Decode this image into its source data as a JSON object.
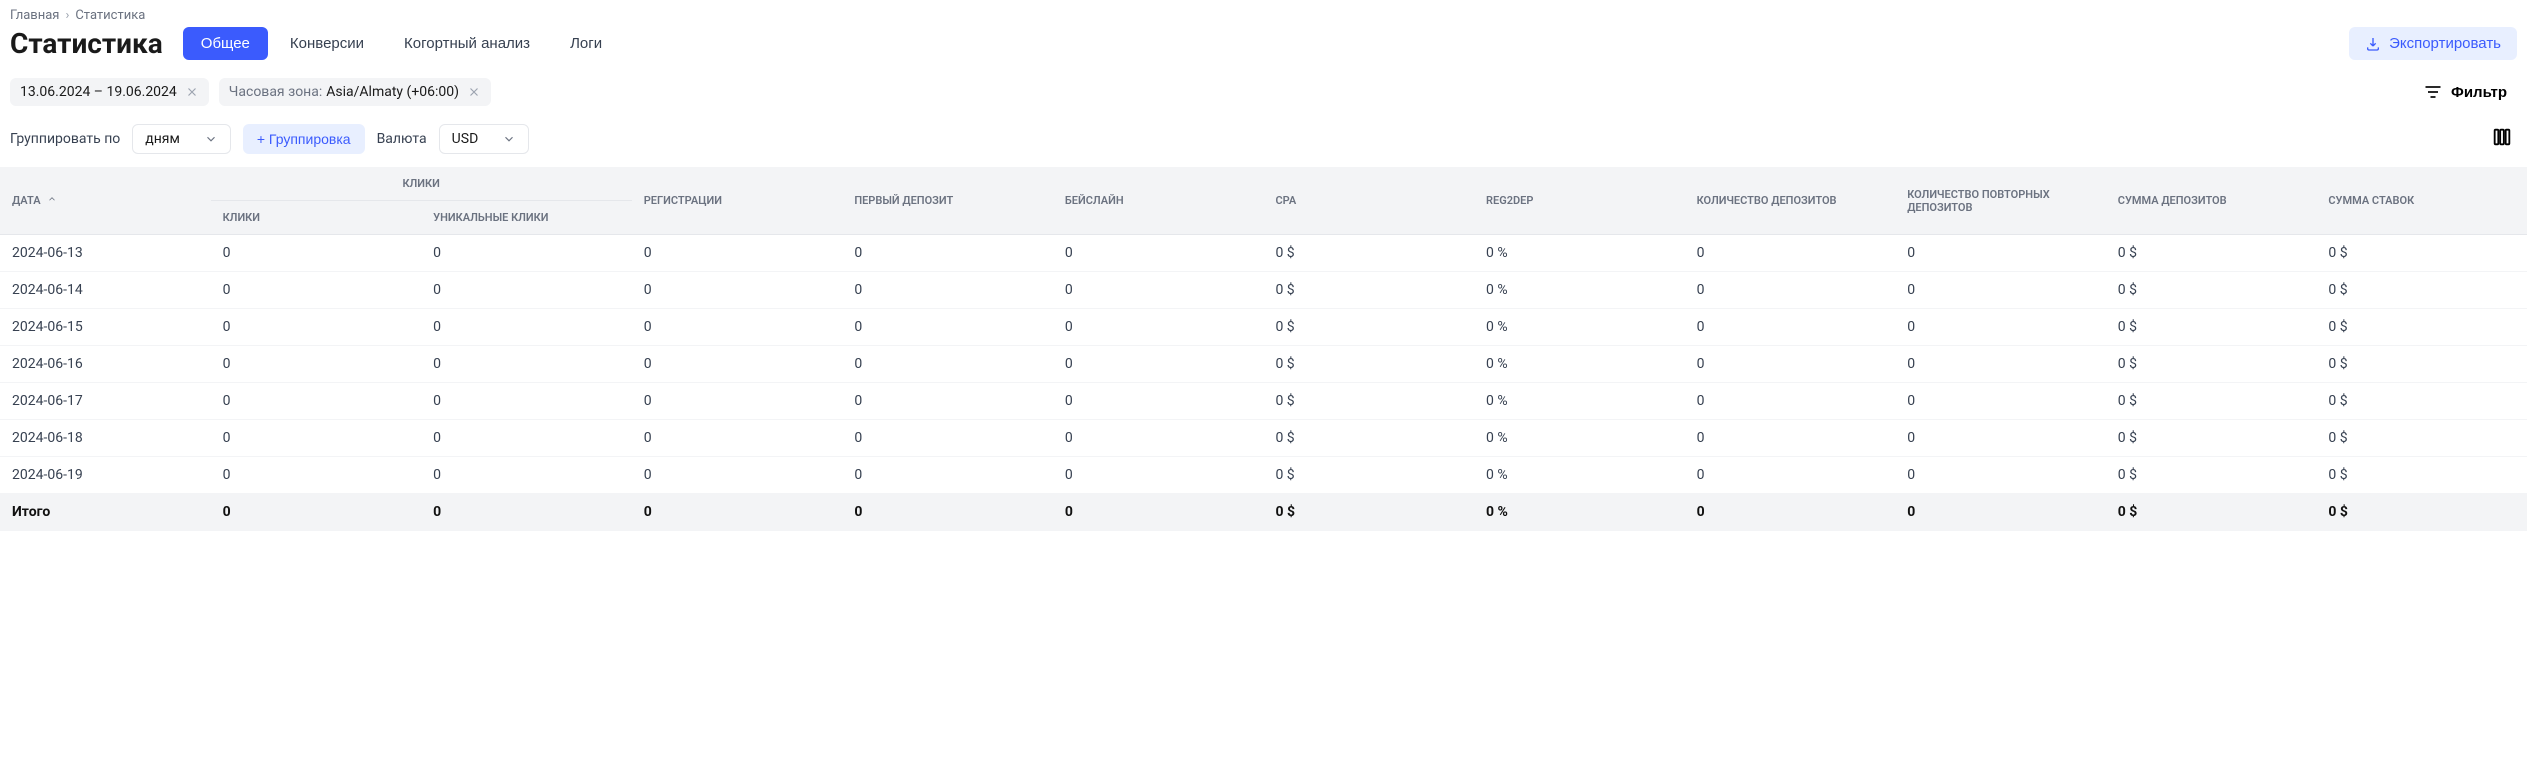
{
  "breadcrumb": {
    "home": "Главная",
    "current": "Статистика"
  },
  "pageTitle": "Статистика",
  "tabs": [
    "Общее",
    "Конверсии",
    "Когортный анализ",
    "Логи"
  ],
  "activeTab": 0,
  "exportLabel": "Экспортировать",
  "filterChips": {
    "dateRange": "13.06.2024 – 19.06.2024",
    "tzLabel": "Часовая зона:",
    "tzValue": "Asia/Almaty (+06:00)"
  },
  "filterBtn": "Фильтр",
  "controls": {
    "groupByLabel": "Группировать по",
    "groupByValue": "дням",
    "addGroupLabel": "+ Группировка",
    "currencyLabel": "Валюта",
    "currencyValue": "USD"
  },
  "columns": {
    "date": "ДАТА",
    "clicksGroup": "КЛИКИ",
    "clicks": "КЛИКИ",
    "uniqueClicks": "УНИКАЛЬНЫЕ КЛИКИ",
    "registrations": "РЕГИСТРАЦИИ",
    "firstDeposit": "ПЕРВЫЙ ДЕПОЗИТ",
    "baseline": "БЕЙСЛАЙН",
    "cpa": "CPA",
    "reg2dep": "REG2DEP",
    "depositsCount": "КОЛИЧЕСТВО ДЕПОЗИТОВ",
    "repeatDepositsCount": "КОЛИЧЕСТВО ПОВТОРНЫХ ДЕПОЗИТОВ",
    "depositsSum": "СУММА ДЕПОЗИТОВ",
    "betsSum": "СУММА СТАВОК"
  },
  "rows": [
    {
      "date": "2024-06-13",
      "clicks": "0",
      "uniqueClicks": "0",
      "registrations": "0",
      "firstDeposit": "0",
      "baseline": "0",
      "cpa": "0 $",
      "reg2dep": "0 %",
      "depositsCount": "0",
      "repeatDepositsCount": "0",
      "depositsSum": "0 $",
      "betsSum": "0 $"
    },
    {
      "date": "2024-06-14",
      "clicks": "0",
      "uniqueClicks": "0",
      "registrations": "0",
      "firstDeposit": "0",
      "baseline": "0",
      "cpa": "0 $",
      "reg2dep": "0 %",
      "depositsCount": "0",
      "repeatDepositsCount": "0",
      "depositsSum": "0 $",
      "betsSum": "0 $"
    },
    {
      "date": "2024-06-15",
      "clicks": "0",
      "uniqueClicks": "0",
      "registrations": "0",
      "firstDeposit": "0",
      "baseline": "0",
      "cpa": "0 $",
      "reg2dep": "0 %",
      "depositsCount": "0",
      "repeatDepositsCount": "0",
      "depositsSum": "0 $",
      "betsSum": "0 $"
    },
    {
      "date": "2024-06-16",
      "clicks": "0",
      "uniqueClicks": "0",
      "registrations": "0",
      "firstDeposit": "0",
      "baseline": "0",
      "cpa": "0 $",
      "reg2dep": "0 %",
      "depositsCount": "0",
      "repeatDepositsCount": "0",
      "depositsSum": "0 $",
      "betsSum": "0 $"
    },
    {
      "date": "2024-06-17",
      "clicks": "0",
      "uniqueClicks": "0",
      "registrations": "0",
      "firstDeposit": "0",
      "baseline": "0",
      "cpa": "0 $",
      "reg2dep": "0 %",
      "depositsCount": "0",
      "repeatDepositsCount": "0",
      "depositsSum": "0 $",
      "betsSum": "0 $"
    },
    {
      "date": "2024-06-18",
      "clicks": "0",
      "uniqueClicks": "0",
      "registrations": "0",
      "firstDeposit": "0",
      "baseline": "0",
      "cpa": "0 $",
      "reg2dep": "0 %",
      "depositsCount": "0",
      "repeatDepositsCount": "0",
      "depositsSum": "0 $",
      "betsSum": "0 $"
    },
    {
      "date": "2024-06-19",
      "clicks": "0",
      "uniqueClicks": "0",
      "registrations": "0",
      "firstDeposit": "0",
      "baseline": "0",
      "cpa": "0 $",
      "reg2dep": "0 %",
      "depositsCount": "0",
      "repeatDepositsCount": "0",
      "depositsSum": "0 $",
      "betsSum": "0 $"
    }
  ],
  "totalLabel": "Итого",
  "total": {
    "clicks": "0",
    "uniqueClicks": "0",
    "registrations": "0",
    "firstDeposit": "0",
    "baseline": "0",
    "cpa": "0 $",
    "reg2dep": "0 %",
    "depositsCount": "0",
    "repeatDepositsCount": "0",
    "depositsSum": "0 $",
    "betsSum": "0 $"
  }
}
